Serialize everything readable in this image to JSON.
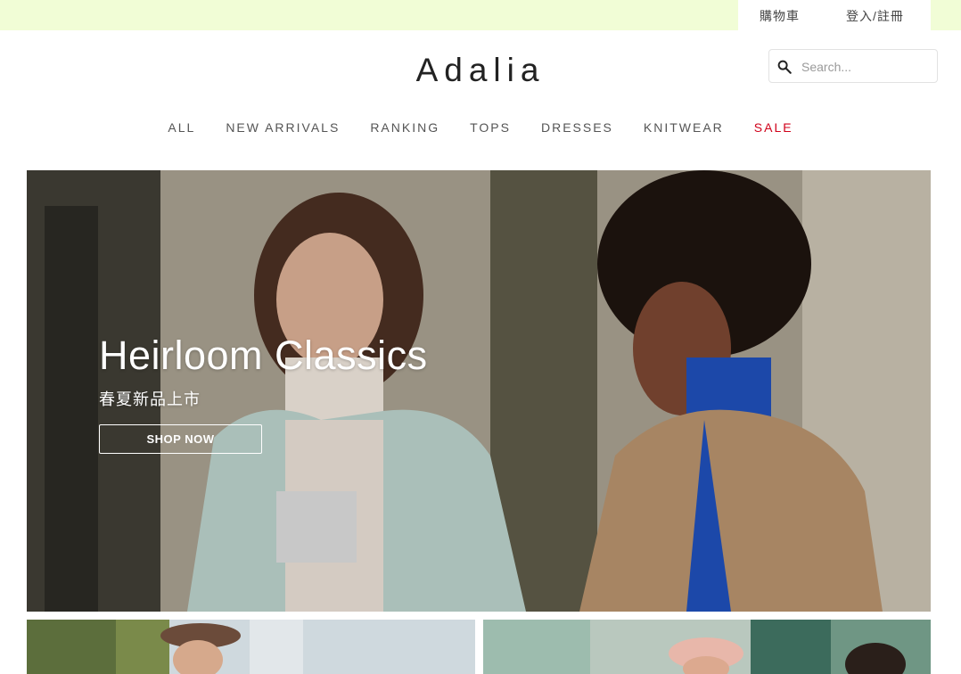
{
  "topbar": {
    "cart_label": "購物車",
    "login_label": "登入/註冊"
  },
  "header": {
    "logo": "Adalia",
    "search_placeholder": "Search..."
  },
  "nav": {
    "items": [
      "ALL",
      "NEW ARRIVALS",
      "RANKING",
      "TOPS",
      "DRESSES",
      "KNITWEAR",
      "SALE"
    ]
  },
  "hero": {
    "title": "Heirloom Classics",
    "subtitle": "春夏新品上市",
    "button_label": "SHOP NOW"
  },
  "colors": {
    "topbar_bg": "#f1fdd6",
    "sale": "#d0021b"
  }
}
